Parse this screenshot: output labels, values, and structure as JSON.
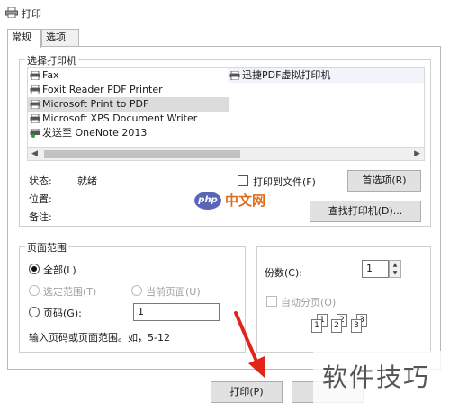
{
  "window": {
    "title": "打印"
  },
  "tabs": [
    {
      "label": "常规"
    },
    {
      "label": "选项"
    }
  ],
  "printer_section": {
    "label": "选择打印机",
    "printers": [
      {
        "name": "Fax",
        "selected": false
      },
      {
        "name": "Foxit Reader PDF Printer",
        "selected": false
      },
      {
        "name": "Microsoft Print to PDF",
        "selected": true
      },
      {
        "name": "Microsoft XPS Document Writer",
        "selected": false
      },
      {
        "name": "发送至 OneNote 2013",
        "selected": false
      },
      {
        "name": "迅捷PDF虚拟打印机",
        "selected": false
      }
    ],
    "status_label": "状态:",
    "status_value": "就绪",
    "location_label": "位置:",
    "comment_label": "备注:",
    "print_to_file_label": "打印到文件(F)",
    "preferences_button": "首选项(R)",
    "find_printer_button": "查找打印机(D)..."
  },
  "page_range": {
    "label": "页面范围",
    "all_label": "全部(L)",
    "selection_label": "选定范围(T)",
    "current_page_label": "当前页面(U)",
    "pages_label": "页码(G):",
    "pages_value": "1",
    "hint": "输入页码或页面范围。如，5-12"
  },
  "copies": {
    "label": "份数(C):",
    "value": "1",
    "collate_label": "自动分页(O)",
    "collate_pages": [
      "1",
      "1",
      "2",
      "2",
      "3",
      "3"
    ]
  },
  "footer": {
    "print_button": "打印(P)"
  },
  "overlay": {
    "logo_badge": "php",
    "logo_text": "中文网",
    "watermark": "软件技巧"
  },
  "colors": {
    "arrow": "#e0251b",
    "selection": "#dcdcdc",
    "logo_badge": "#5b65b8"
  },
  "icons": {
    "app": "printer-icon",
    "printer_row": "printer-icon",
    "network_printer": "network-printer-icon"
  }
}
